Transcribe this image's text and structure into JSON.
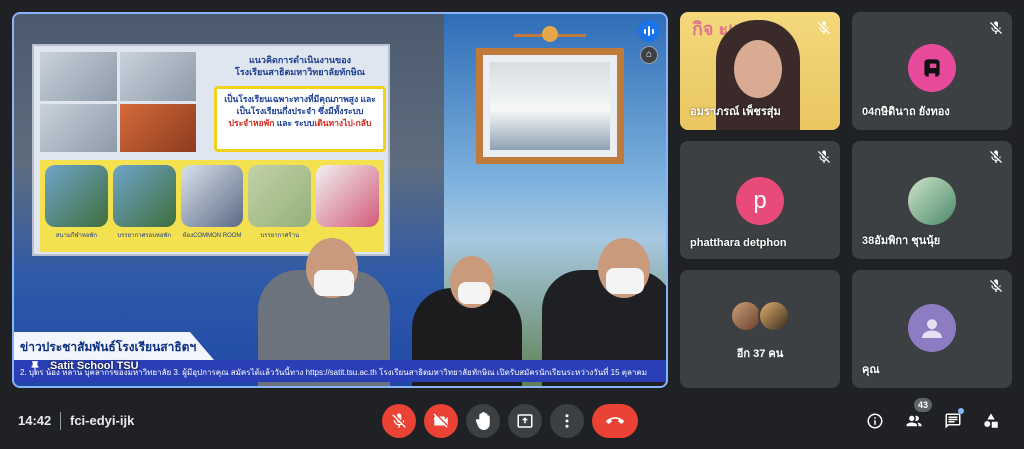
{
  "stage": {
    "presenter_name": "Satit School TSU",
    "news_label": "ข่าวประชาสัมพันธ์โรงเรียนสาธิตฯ",
    "ticker": "2. บุตร น้อง หลาน บุคลากรของมหาวิทยาลัย 3. ผู้มีอุปการคุณ สมัครได้แล้ววันนี้ทาง https://satit.tsu.ac.th โรงเรียนสาธิตมหาวิทยาลัยทักษิณ เปิดรับสมัครนักเรียนระหว่างวันที่ 15 ตุลาคม",
    "poster": {
      "title_line1": "แนวคิดการดำเนินงานของ",
      "title_line2": "โรงเรียนสาธิตมหาวิทยาลัยทักษิณ",
      "box_line1": "เป็นโรงเรียนเฉพาะทางที่มีคุณภาพสูง และ",
      "box_line2": "เป็นโรงเรียนกึ่งประจำ ซึ่งมีทั้งระบบ",
      "box_line3_a": "ประจำหอพัก",
      "box_line3_b": " และ ระบบ",
      "box_line3_c": "เดินทางไป-กลับ",
      "captions": [
        "สนามกีฬาหอพัก",
        "บรรยากาศรอบหอพัก",
        "ห้องCOMMON ROOM",
        "บรรยากาศร้าน",
        ""
      ]
    }
  },
  "participants": [
    {
      "name": "อมราภรณ์ เพ็ชรสุ่ม",
      "type": "video",
      "muted": true,
      "overlay_text": "กิจ ะแนะ"
    },
    {
      "name": "04กษิดินาถ ยังทอง",
      "type": "avatar-image",
      "muted": true,
      "avatar_color": "#e84a9a"
    },
    {
      "name": "phatthara detphon",
      "type": "initial",
      "initial": "p",
      "muted": true,
      "avatar_color": "#e84a7a"
    },
    {
      "name": "38อัมพิกา ชุนนุ้ย",
      "type": "avatar-image",
      "muted": true,
      "avatar_color": "#4a8a6a"
    },
    {
      "name": "",
      "type": "others",
      "others_label": "อีก 37 คน",
      "muted": true
    },
    {
      "name": "คุณ",
      "type": "self",
      "muted": true,
      "avatar_color": "#8e7cc3"
    }
  ],
  "bottom": {
    "time": "14:42",
    "meeting_code": "fci-edyi-ijk",
    "people_count": "43"
  },
  "colors": {
    "background": "#202124",
    "tile": "#3c4043",
    "danger": "#ea4335",
    "active_border": "#8ab4f8"
  },
  "icons": [
    "mic-off-icon",
    "camera-off-icon",
    "raise-hand-icon",
    "present-icon",
    "more-options-icon",
    "hang-up-icon",
    "info-icon",
    "people-icon",
    "chat-icon",
    "activities-icon",
    "speaking-icon",
    "pin-icon"
  ]
}
